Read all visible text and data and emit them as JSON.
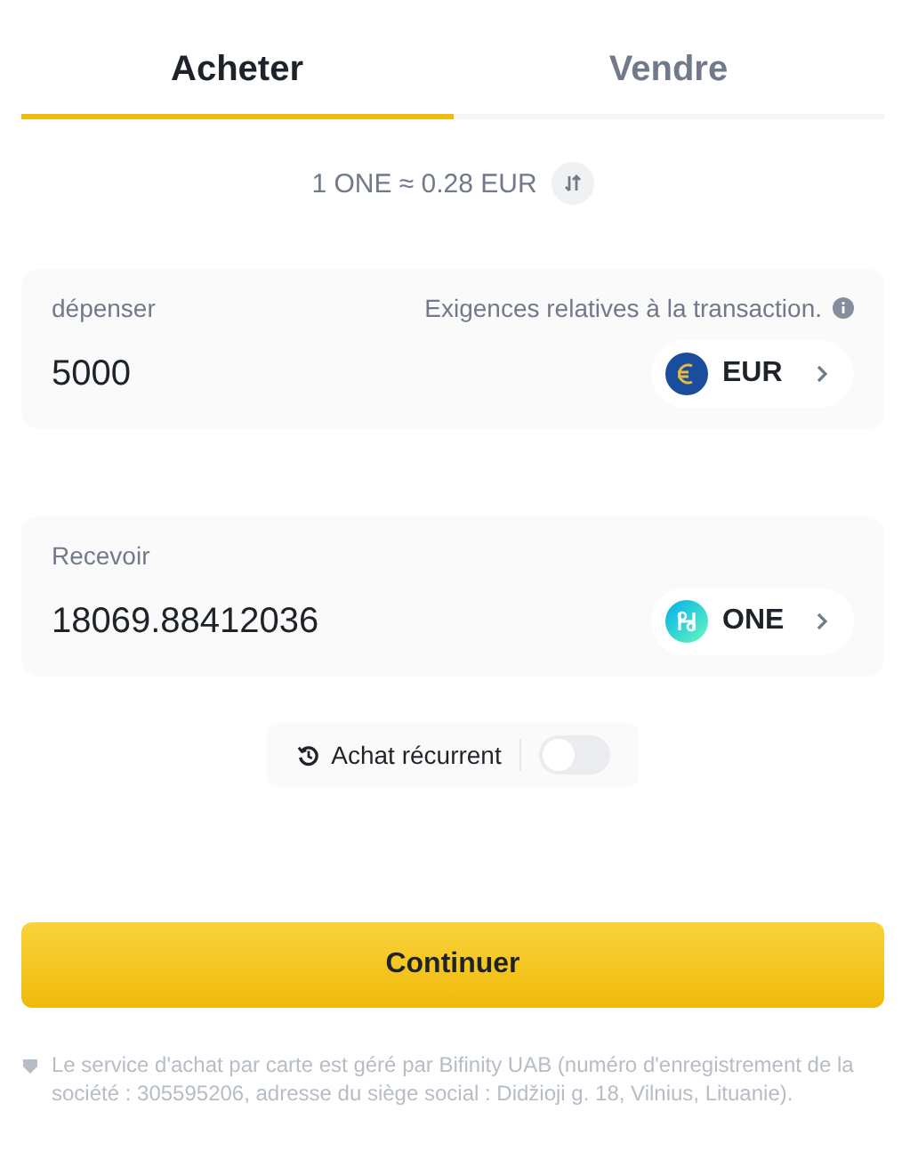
{
  "tabs": [
    {
      "label": "Acheter",
      "selected": true
    },
    {
      "label": "Vendre",
      "selected": false
    }
  ],
  "rate": {
    "text": "1 ONE ≈ 0.28 EUR"
  },
  "spend": {
    "label": "dépenser",
    "requirements": "Exigences relatives à la transaction.",
    "value": "5000",
    "currency": {
      "code": "EUR",
      "kind": "euro"
    }
  },
  "receive": {
    "label": "Recevoir",
    "value": "18069.88412036",
    "currency": {
      "code": "ONE",
      "kind": "harmony"
    }
  },
  "recurring": {
    "label": "Achat récurrent",
    "on": false
  },
  "continue_button": "Continuer",
  "footer": "Le service d'achat par carte est géré par Bifinity UAB (numéro d'enregistrement de la société : 305595206, adresse du siège social : Didžioji g. 18, Vilnius, Lituanie)."
}
